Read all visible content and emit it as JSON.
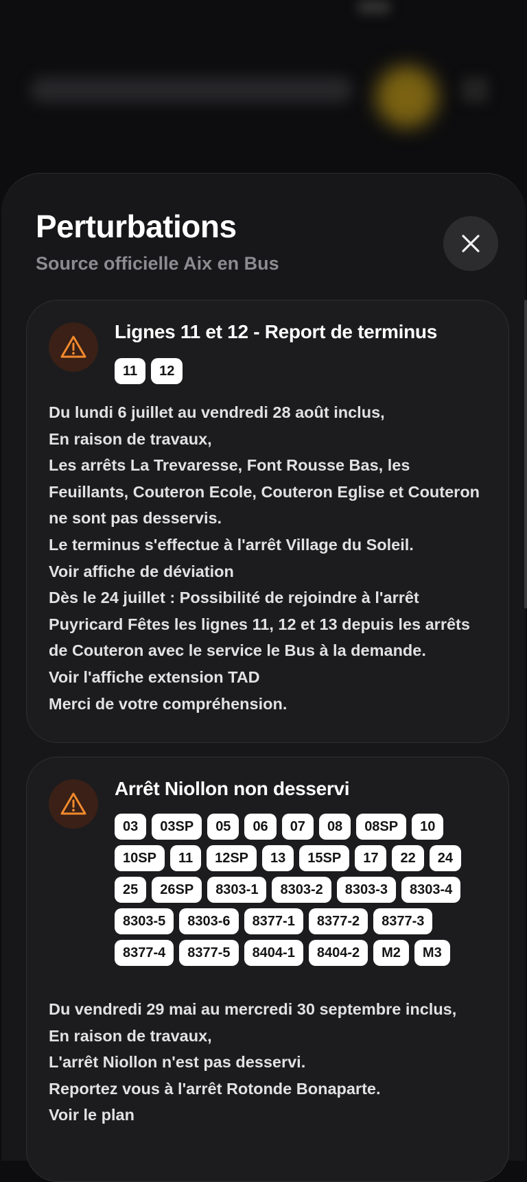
{
  "sheet": {
    "title": "Perturbations",
    "subtitle": "Source officielle Aix en Bus",
    "close_icon": "close-icon"
  },
  "colors": {
    "warning_accent": "#f28a2e",
    "warning_bg": "#3a2016",
    "chip_bg": "#ffffff"
  },
  "disruptions": [
    {
      "icon": "warning-triangle-icon",
      "title": "Lignes 11 et 12 - Report de terminus",
      "lines": [
        "11",
        "12"
      ],
      "description": [
        "Du lundi 6 juillet au vendredi 28 août inclus,",
        "En raison de travaux,",
        "Les arrêts La Trevaresse, Font Rousse Bas, les",
        "Feuillants, Couteron Ecole, Couteron Eglise et Couteron",
        "ne sont pas desservis.",
        "Le terminus s'effectue à l'arrêt Village du Soleil.",
        "Voir affiche de déviation",
        "Dès le 24 juillet : Possibilité de rejoindre à l'arrêt",
        "Puyricard Fêtes les lignes 11, 12 et 13 depuis les arrêts",
        "de Couteron avec le service le Bus à la demande.",
        "Voir l'affiche extension TAD",
        "Merci de votre compréhension."
      ]
    },
    {
      "icon": "warning-triangle-icon",
      "title": "Arrêt Niollon non desservi",
      "lines": [
        "03",
        "03SP",
        "05",
        "06",
        "07",
        "08",
        "08SP",
        "10",
        "10SP",
        "11",
        "12SP",
        "13",
        "15SP",
        "17",
        "22",
        "24",
        "25",
        "26SP",
        "8303-1",
        "8303-2",
        "8303-3",
        "8303-4",
        "8303-5",
        "8303-6",
        "8377-1",
        "8377-2",
        "8377-3",
        "8377-4",
        "8377-5",
        "8404-1",
        "8404-2",
        "M2",
        "M3"
      ],
      "description": [
        "Du vendredi 29 mai au mercredi 30 septembre inclus,",
        "En raison de travaux,",
        "L'arrêt Niollon n'est pas desservi.",
        "Reportez vous à l'arrêt Rotonde Bonaparte.",
        "Voir le plan"
      ]
    }
  ]
}
